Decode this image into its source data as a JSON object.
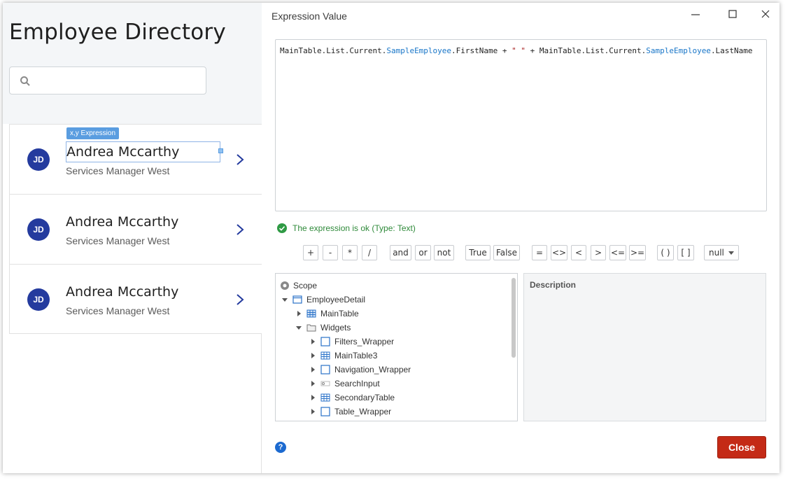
{
  "app": {
    "title": "Employee Directory",
    "search_placeholder": ""
  },
  "employees": [
    {
      "initials": "JD",
      "name": "Andrea Mccarthy",
      "role": "Services Manager West"
    },
    {
      "initials": "JD",
      "name": "Andrea Mccarthy",
      "role": "Services Manager West"
    },
    {
      "initials": "JD",
      "name": "Andrea Mccarthy",
      "role": "Services Manager West"
    }
  ],
  "selection_badge": "x,y  Expression",
  "dialog": {
    "title": "Expression Value",
    "expression": {
      "p1": "MainTable.List.Current.",
      "p2": "SampleEmployee",
      "p3": ".FirstName + ",
      "p4": " \" \" ",
      "p5": "+ MainTable.List.Current.",
      "p6": "SampleEmployee",
      "p7": ".LastName"
    },
    "status": "The expression is ok (Type: Text)",
    "operators": [
      "+",
      "-",
      "*",
      "/",
      "and",
      "or",
      "not",
      "True",
      "False",
      "=",
      "<>",
      "<",
      ">",
      "<=",
      ">=",
      "( )",
      "[ ]"
    ],
    "null_option": "null",
    "tree": [
      {
        "label": "Scope",
        "kind": "scope"
      },
      {
        "label": "EmployeeDetail",
        "kind": "screen"
      },
      {
        "label": "MainTable",
        "kind": "table"
      },
      {
        "label": "Widgets",
        "kind": "folder"
      },
      {
        "label": "Filters_Wrapper",
        "kind": "container"
      },
      {
        "label": "MainTable3",
        "kind": "table2"
      },
      {
        "label": "Navigation_Wrapper",
        "kind": "container"
      },
      {
        "label": "SearchInput",
        "kind": "input"
      },
      {
        "label": "SecondaryTable",
        "kind": "table2"
      },
      {
        "label": "Table_Wrapper",
        "kind": "container"
      }
    ],
    "description_title": "Description",
    "help_label": "?",
    "close_label": "Close"
  },
  "colors": {
    "accent": "#243b9e",
    "ok": "#2f8a3a",
    "close_button": "#c42a16",
    "reference": "#1976c8"
  }
}
